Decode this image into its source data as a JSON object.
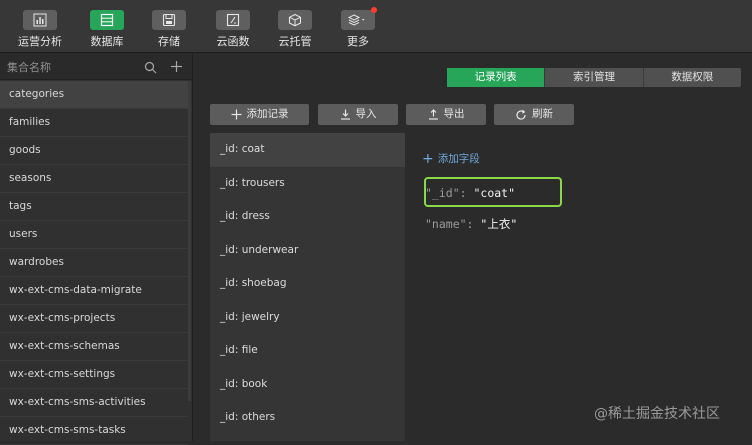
{
  "toolbar": {
    "items": [
      {
        "label": "运营分析",
        "icon": "bar-chart-icon",
        "active": false
      },
      {
        "label": "数据库",
        "icon": "database-icon",
        "active": true
      },
      {
        "label": "存储",
        "icon": "storage-icon",
        "active": false
      },
      {
        "label": "云函数",
        "icon": "cloud-function-icon",
        "active": false
      },
      {
        "label": "云托管",
        "icon": "cube-icon",
        "active": false
      },
      {
        "label": "更多",
        "icon": "layers-icon",
        "active": false,
        "has_badge": true
      }
    ],
    "accent_color": "#27a659",
    "badge_color": "#ff3b30"
  },
  "sidebar": {
    "search_placeholder": "集合名称",
    "collections": [
      "categories",
      "families",
      "goods",
      "seasons",
      "tags",
      "users",
      "wardrobes",
      "wx-ext-cms-data-migrate",
      "wx-ext-cms-projects",
      "wx-ext-cms-schemas",
      "wx-ext-cms-settings",
      "wx-ext-cms-sms-activities",
      "wx-ext-cms-sms-tasks"
    ],
    "selected": "categories"
  },
  "tabs": [
    {
      "label": "记录列表",
      "active": true
    },
    {
      "label": "索引管理",
      "active": false
    },
    {
      "label": "数据权限",
      "active": false
    }
  ],
  "actions": {
    "add_record": "添加记录",
    "import": "导入",
    "export": "导出",
    "refresh": "刷新"
  },
  "records": [
    "_id: coat",
    "_id: trousers",
    "_id: dress",
    "_id: underwear",
    "_id: shoebag",
    "_id: jewelry",
    "_id: file",
    "_id: book",
    "_id: others"
  ],
  "detail": {
    "add_field": "添加字段",
    "fields": [
      {
        "key": "\"_id\":",
        "value": "\"coat\""
      },
      {
        "key": "\"name\":",
        "value": "\"上衣\""
      }
    ],
    "highlight_color": "#8bd94a"
  },
  "watermark": "@稀土掘金技术社区"
}
